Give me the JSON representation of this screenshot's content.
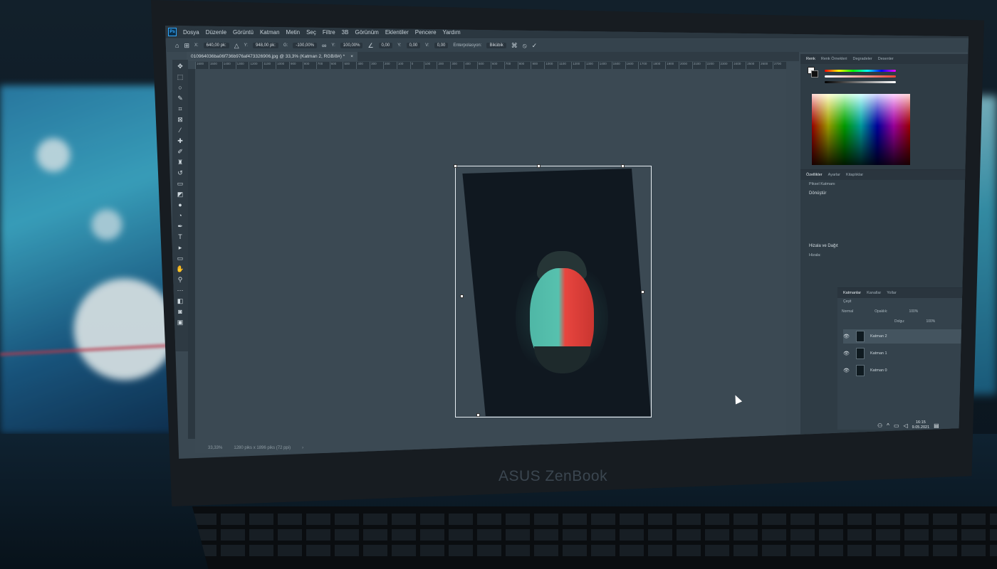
{
  "app": {
    "logo": "Ps"
  },
  "menu": [
    "Dosya",
    "Düzenle",
    "Görüntü",
    "Katman",
    "Metin",
    "Seç",
    "Filtre",
    "3B",
    "Görünüm",
    "Eklentiler",
    "Pencere",
    "Yardım"
  ],
  "options": {
    "x_label": "X:",
    "x_value": "640,00 pk:",
    "y_label": "Y:",
    "y_value": "948,00 pk:",
    "w_label": "G:",
    "w_value": "-100,00%",
    "h_label": "Y:",
    "h_value": "100,00%",
    "angle_value": "0,00",
    "hskew_label": "Y:",
    "hskew_value": "0,00",
    "vskew_label": "V:",
    "vskew_value": "0,00",
    "interp_label": "Enterpolasyon:",
    "interp_value": "Bikübik",
    "cancel_icon": "cancel-icon",
    "commit_icon": "commit-icon"
  },
  "document": {
    "tab_title": "010964036ba06f736b976af473326906.jpg @ 33,3% (Katman 2, RGB/8#) *",
    "close": "×"
  },
  "ruler": [
    "1600",
    "1500",
    "1400",
    "1300",
    "1200",
    "1100",
    "1000",
    "900",
    "800",
    "700",
    "600",
    "500",
    "400",
    "300",
    "200",
    "100",
    "0",
    "100",
    "200",
    "300",
    "400",
    "500",
    "600",
    "700",
    "800",
    "900",
    "1000",
    "1100",
    "1200",
    "1300",
    "1400",
    "1500",
    "1600",
    "1700",
    "1800",
    "1900",
    "2000",
    "2100",
    "2200",
    "2300",
    "2400",
    "2500",
    "2600",
    "2700"
  ],
  "status": {
    "zoom": "33,33%",
    "size": "1280 piks x 1896 piks (72 ppi)",
    "arrow": "›"
  },
  "panels": {
    "top_tabs": [
      "Renk",
      "Renk Örnekleri",
      "Degradeler",
      "Desenler"
    ],
    "properties_tabs": [
      "Özellikler",
      "Ayarlar",
      "Kitaplıklar"
    ],
    "pixel_layer": "Piksel Katmanı",
    "transform_title": "Dönüştür",
    "align_title": "Hizala ve Dağıt",
    "align_sub": "Hizala:",
    "layers_tabs": [
      "Katmanlar",
      "Kanallar",
      "Yollar"
    ],
    "search": "Çeşit",
    "blend_mode": "Normal",
    "opacity_label": "Opaklık:",
    "opacity_value": "100%",
    "fill_label": "Dolgu:",
    "fill_value": "100%",
    "layers": [
      "Katman 2",
      "Katman 1",
      "Katman 0"
    ]
  },
  "taskbar": {
    "time": "16:15",
    "date": "9.05.2021"
  },
  "laptop": {
    "brand": "ASUS ZenBook"
  },
  "colors": {
    "accent": "#31a8ff",
    "panel": "#2f3c45",
    "canvas": "#3b4953"
  }
}
